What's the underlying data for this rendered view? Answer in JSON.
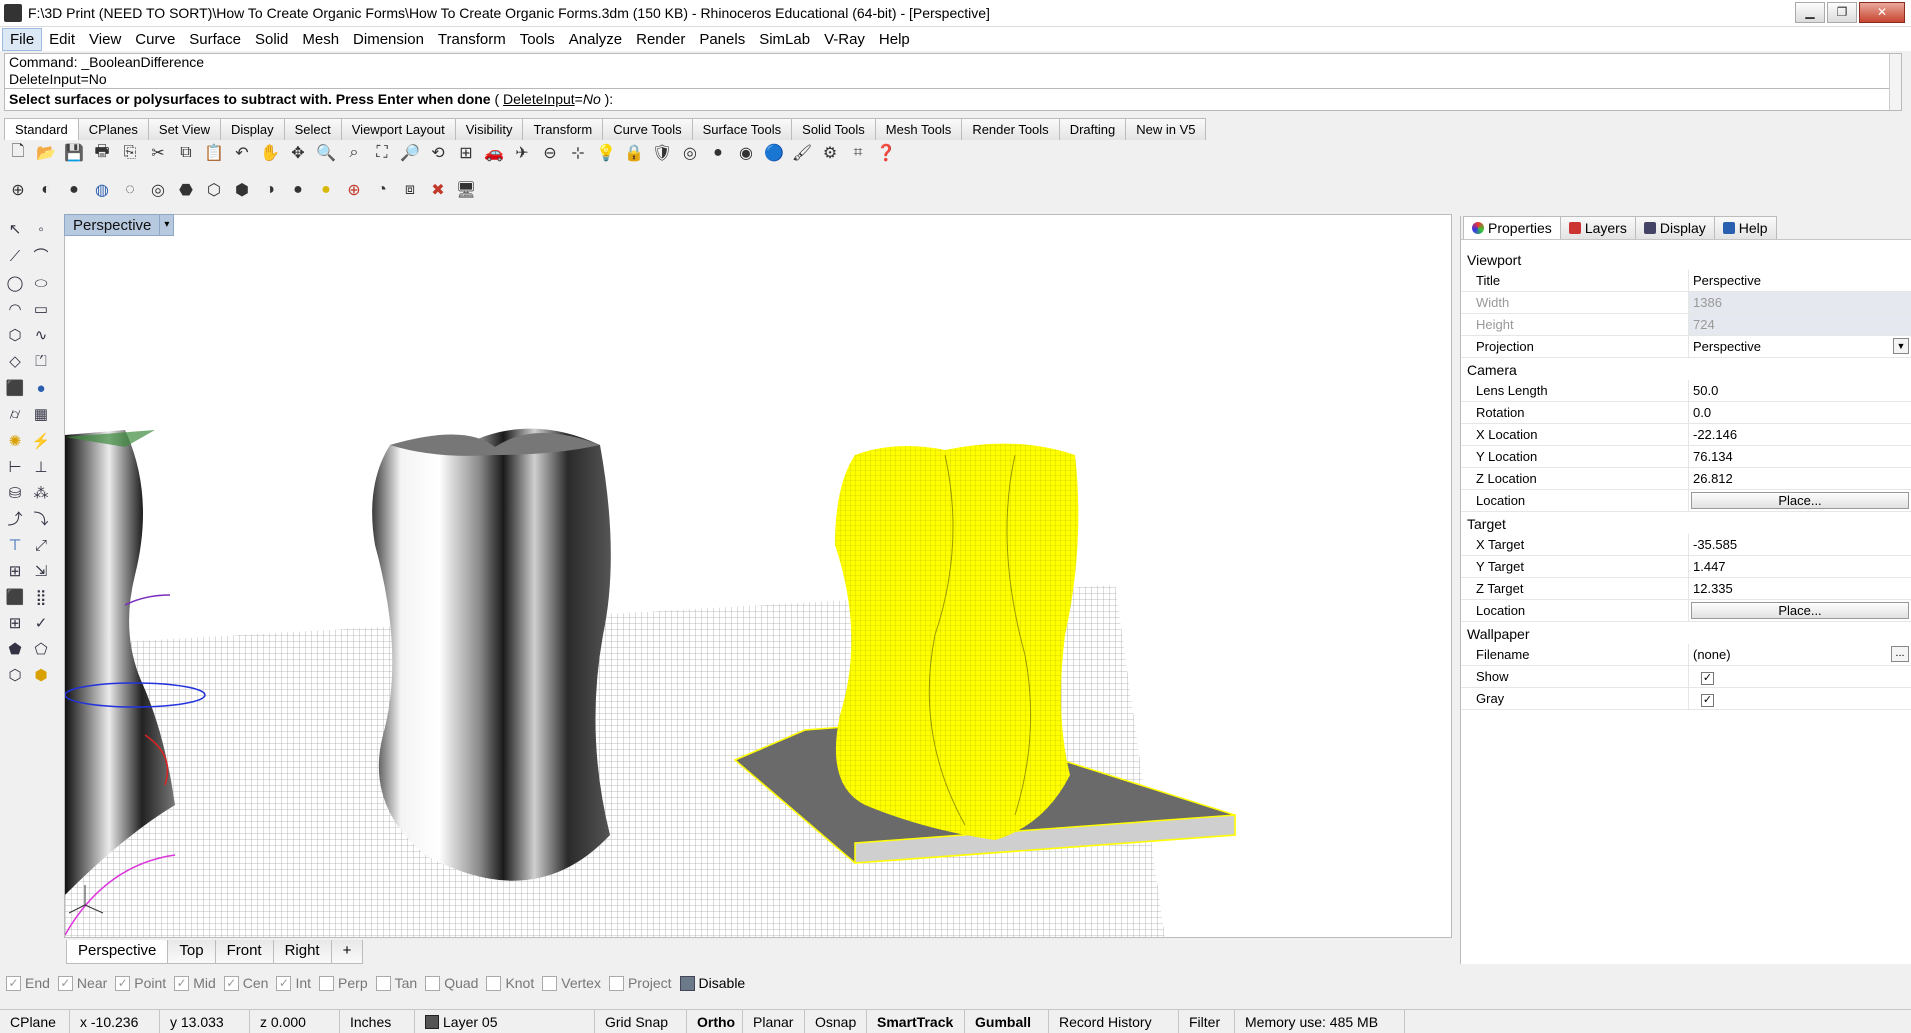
{
  "window": {
    "title": "F:\\3D Print (NEED TO SORT)\\How To Create Organic Forms\\How To Create Organic Forms.3dm (150 KB) - Rhinoceros Educational (64-bit) - [Perspective]"
  },
  "menu": [
    "File",
    "Edit",
    "View",
    "Curve",
    "Surface",
    "Solid",
    "Mesh",
    "Dimension",
    "Transform",
    "Tools",
    "Analyze",
    "Render",
    "Panels",
    "SimLab",
    "V-Ray",
    "Help"
  ],
  "command": {
    "history1": "Command: _BooleanDifference",
    "history2": "DeleteInput=No",
    "prompt": "Select surfaces or polysurfaces to subtract with. Press Enter when done",
    "option_open": " ( ",
    "option_name": "DeleteInput",
    "option_eq": "=",
    "option_value": "No",
    "option_close": " ):"
  },
  "toolbar_tabs": [
    "Standard",
    "CPlanes",
    "Set View",
    "Display",
    "Select",
    "Viewport Layout",
    "Visibility",
    "Transform",
    "Curve Tools",
    "Surface Tools",
    "Solid Tools",
    "Mesh Tools",
    "Render Tools",
    "Drafting",
    "New in V5"
  ],
  "viewport": {
    "name": "Perspective",
    "dropdown": "▾"
  },
  "view_tabs": [
    "Perspective",
    "Top",
    "Front",
    "Right",
    "+"
  ],
  "osnaps": [
    {
      "label": "End",
      "checked": true
    },
    {
      "label": "Near",
      "checked": true
    },
    {
      "label": "Point",
      "checked": true
    },
    {
      "label": "Mid",
      "checked": true
    },
    {
      "label": "Cen",
      "checked": true
    },
    {
      "label": "Int",
      "checked": true
    },
    {
      "label": "Perp",
      "checked": false
    },
    {
      "label": "Tan",
      "checked": false
    },
    {
      "label": "Quad",
      "checked": false
    },
    {
      "label": "Knot",
      "checked": false
    },
    {
      "label": "Vertex",
      "checked": false
    },
    {
      "label": "Project",
      "checked": false
    },
    {
      "label": "Disable",
      "checked": true
    }
  ],
  "status": {
    "cplane": "CPlane",
    "x": "x -10.236",
    "y": "y 13.033",
    "z": "z 0.000",
    "units": "Inches",
    "layer": "Layer 05",
    "grid_snap": "Grid Snap",
    "ortho": "Ortho",
    "planar": "Planar",
    "osnap": "Osnap",
    "smarttrack": "SmartTrack",
    "gumball": "Gumball",
    "record_history": "Record History",
    "filter": "Filter",
    "memory": "Memory use: 485 MB"
  },
  "panel": {
    "tabs": [
      "Properties",
      "Layers",
      "Display",
      "Help"
    ],
    "viewport_section": "Viewport",
    "title_k": "Title",
    "title_v": "Perspective",
    "width_k": "Width",
    "width_v": "1386",
    "height_k": "Height",
    "height_v": "724",
    "projection_k": "Projection",
    "projection_v": "Perspective",
    "camera_section": "Camera",
    "lens_k": "Lens Length",
    "lens_v": "50.0",
    "rotation_k": "Rotation",
    "rotation_v": "0.0",
    "xloc_k": "X Location",
    "xloc_v": "-22.146",
    "yloc_k": "Y Location",
    "yloc_v": "76.134",
    "zloc_k": "Z Location",
    "zloc_v": "26.812",
    "loc_k": "Location",
    "place_label": "Place...",
    "target_section": "Target",
    "xt_k": "X Target",
    "xt_v": "-35.585",
    "yt_k": "Y Target",
    "yt_v": "1.447",
    "zt_k": "Z Target",
    "zt_v": "12.335",
    "tloc_k": "Location",
    "wallpaper_section": "Wallpaper",
    "filename_k": "Filename",
    "filename_v": "(none)",
    "ellipsis": "...",
    "show_k": "Show",
    "gray_k": "Gray"
  },
  "colors": {
    "selection_yellow": "#ffff00",
    "viewport_label": "#b7c9de",
    "grid": "#a8a8a8"
  }
}
